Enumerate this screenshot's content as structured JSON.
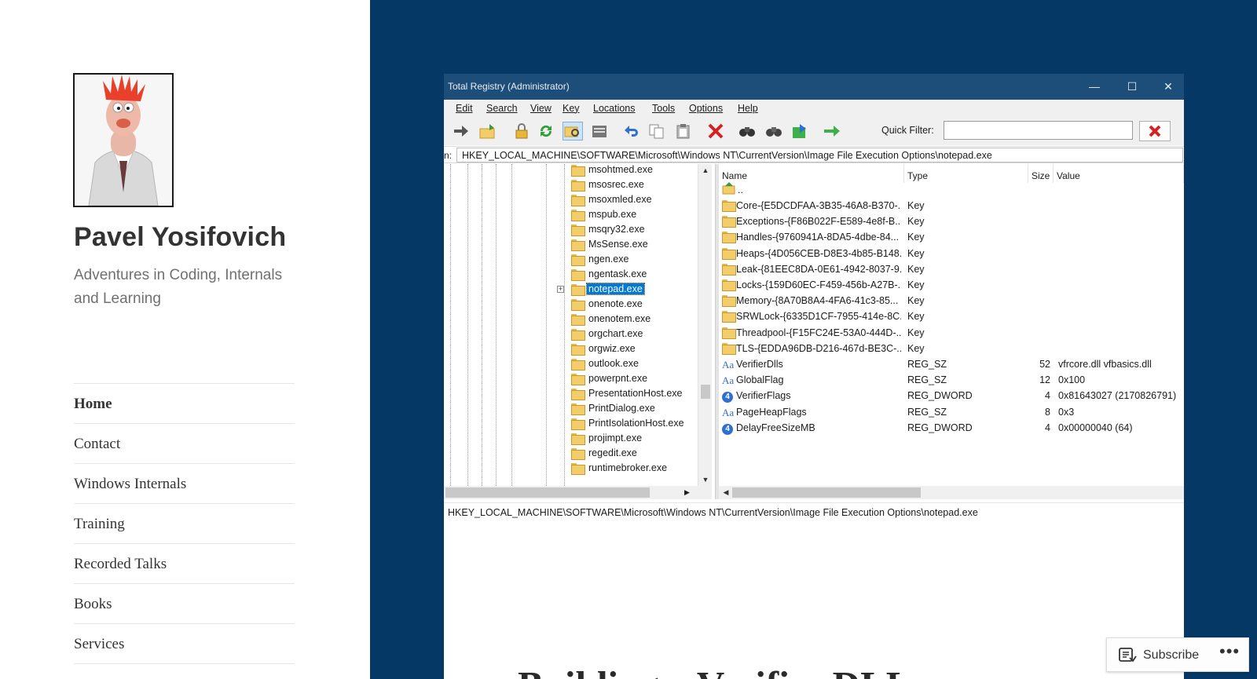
{
  "site": {
    "title": "Pavel Yosifovich",
    "description": "Adventures in Coding, Internals and Learning"
  },
  "nav": [
    {
      "label": "Home",
      "active": true
    },
    {
      "label": "Contact"
    },
    {
      "label": "Windows Internals"
    },
    {
      "label": "Training"
    },
    {
      "label": "Recorded Talks"
    },
    {
      "label": "Books"
    },
    {
      "label": "Services"
    }
  ],
  "post": {
    "title": "Building a Verifier DLL"
  },
  "registry_app": {
    "window_title": "Total Registry (Administrator)",
    "window_buttons": [
      "minimize",
      "maximize",
      "close"
    ],
    "menu": [
      "Edit",
      "Search",
      "View",
      "Key",
      "Locations",
      "Tools",
      "Options",
      "Help"
    ],
    "quick_filter_label": "Quick Filter:",
    "quick_filter_value": "",
    "address_prefix": "n:",
    "address": "HKEY_LOCAL_MACHINE\\SOFTWARE\\Microsoft\\Windows NT\\CurrentVersion\\Image File Execution Options\\notepad.exe",
    "tree_items": [
      {
        "label": "msohtmed.exe"
      },
      {
        "label": "msosrec.exe"
      },
      {
        "label": "msoxmled.exe"
      },
      {
        "label": "mspub.exe"
      },
      {
        "label": "msqry32.exe"
      },
      {
        "label": "MsSense.exe"
      },
      {
        "label": "ngen.exe"
      },
      {
        "label": "ngentask.exe"
      },
      {
        "label": "notepad.exe",
        "selected": true
      },
      {
        "label": "onenote.exe"
      },
      {
        "label": "onenotem.exe"
      },
      {
        "label": "orgchart.exe"
      },
      {
        "label": "orgwiz.exe"
      },
      {
        "label": "outlook.exe"
      },
      {
        "label": "powerpnt.exe"
      },
      {
        "label": "PresentationHost.exe"
      },
      {
        "label": "PrintDialog.exe"
      },
      {
        "label": "PrintIsolationHost.exe"
      },
      {
        "label": "projimpt.exe"
      },
      {
        "label": "regedit.exe"
      },
      {
        "label": "runtimebroker.exe"
      }
    ],
    "columns": [
      "Name",
      "Type",
      "Size",
      "Value"
    ],
    "parent_row": "..",
    "rows": [
      {
        "icon": "folder",
        "name": "Core-{E5DCDFAA-3B35-46A8-B370-...",
        "type": "Key",
        "size": "",
        "value": ""
      },
      {
        "icon": "folder",
        "name": "Exceptions-{F86B022F-E589-4e8f-B...",
        "type": "Key",
        "size": "",
        "value": ""
      },
      {
        "icon": "folder",
        "name": "Handles-{9760941A-8DA5-4dbe-84...",
        "type": "Key",
        "size": "",
        "value": ""
      },
      {
        "icon": "folder",
        "name": "Heaps-{4D056CEB-D8E3-4b85-B148...",
        "type": "Key",
        "size": "",
        "value": ""
      },
      {
        "icon": "folder",
        "name": "Leak-{81EEC8DA-0E61-4942-8037-9...",
        "type": "Key",
        "size": "",
        "value": ""
      },
      {
        "icon": "folder",
        "name": "Locks-{159D60EC-F459-456b-A27B-...",
        "type": "Key",
        "size": "",
        "value": ""
      },
      {
        "icon": "folder",
        "name": "Memory-{8A70B8A4-4FA6-41c3-85...",
        "type": "Key",
        "size": "",
        "value": ""
      },
      {
        "icon": "folder",
        "name": "SRWLock-{6335D1CF-7955-414e-8C...",
        "type": "Key",
        "size": "",
        "value": ""
      },
      {
        "icon": "folder",
        "name": "Threadpool-{F15FC24E-53A0-444D-...",
        "type": "Key",
        "size": "",
        "value": ""
      },
      {
        "icon": "folder",
        "name": "TLS-{EDDA96DB-D216-467d-BE3C-...",
        "type": "Key",
        "size": "",
        "value": ""
      },
      {
        "icon": "string",
        "name": "VerifierDlls",
        "type": "REG_SZ",
        "size": "52",
        "value": "vfrcore.dll vfbasics.dll"
      },
      {
        "icon": "string",
        "name": "GlobalFlag",
        "type": "REG_SZ",
        "size": "12",
        "value": "0x100"
      },
      {
        "icon": "dword",
        "name": "VerifierFlags",
        "type": "REG_DWORD",
        "size": "4",
        "value": "0x81643027 (2170826791)"
      },
      {
        "icon": "string",
        "name": "PageHeapFlags",
        "type": "REG_SZ",
        "size": "8",
        "value": "0x3"
      },
      {
        "icon": "dword",
        "name": "DelayFreeSizeMB",
        "type": "REG_DWORD",
        "size": "4",
        "value": "0x00000040 (64)"
      }
    ],
    "string_icon_text": "Aa",
    "dword_icon_text": "4",
    "status": "HKEY_LOCAL_MACHINE\\SOFTWARE\\Microsoft\\Windows NT\\CurrentVersion\\Image File Execution Options\\notepad.exe"
  },
  "subscribe": {
    "label": "Subscribe",
    "more": "•••"
  },
  "colors": {
    "content_bg": "#063865",
    "titlebar_bg": "#1d4e79",
    "selection": "#0078d7"
  }
}
